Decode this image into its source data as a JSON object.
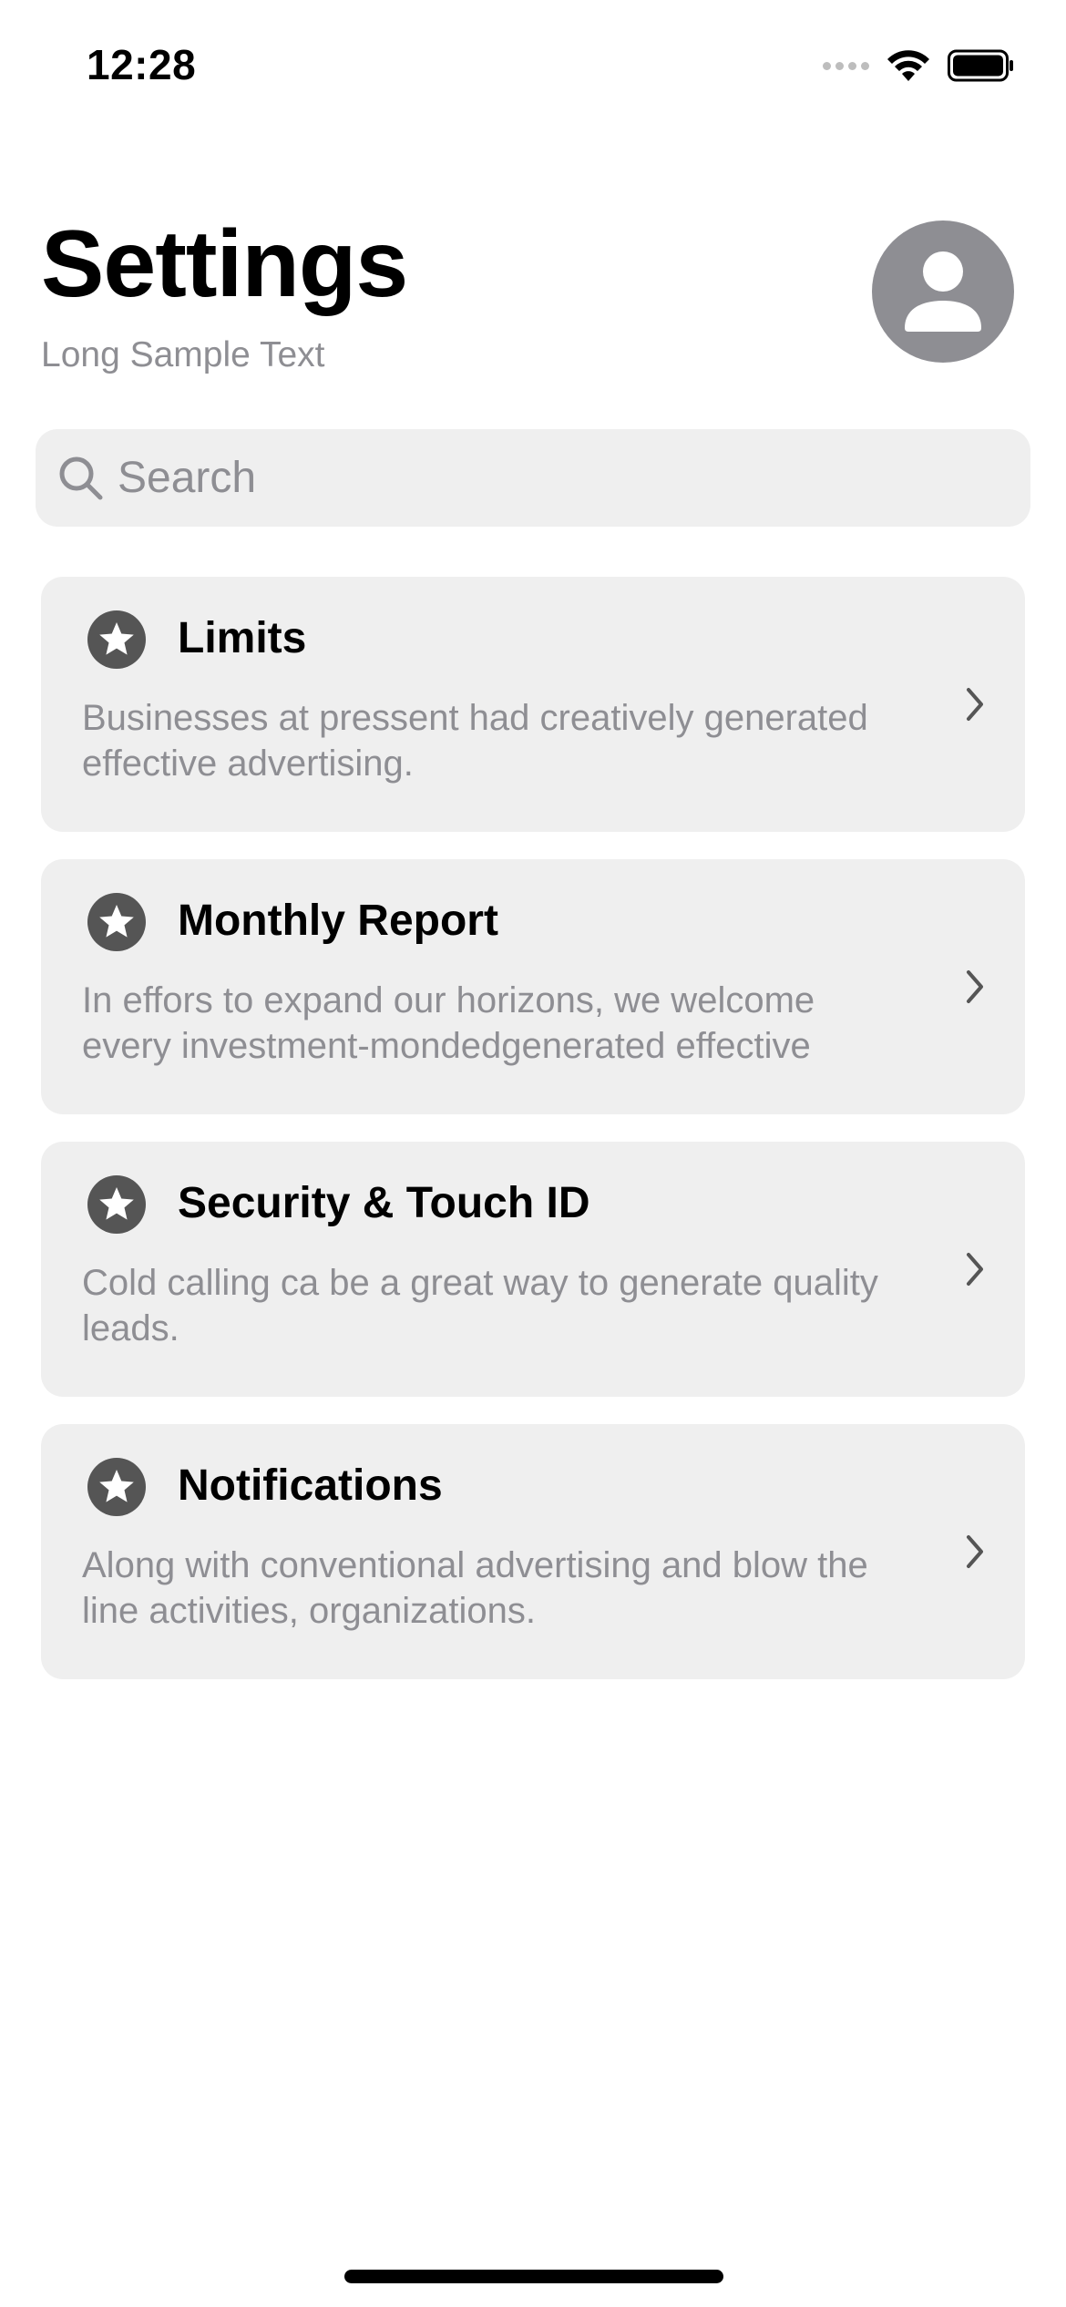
{
  "status_bar": {
    "time": "12:28"
  },
  "header": {
    "title": "Settings",
    "subtitle": "Long Sample Text"
  },
  "search": {
    "placeholder": "Search",
    "value": ""
  },
  "colors": {
    "card_background": "#efefef",
    "icon_fill": "#555555",
    "avatar_background": "#8e8e93",
    "secondary_text": "#8e8e93"
  },
  "items": [
    {
      "title": "Limits",
      "description": "Businesses at pressent had creatively generated effective advertising.",
      "icon": "star-icon"
    },
    {
      "title": "Monthly Report",
      "description": "In effors to expand our horizons, we welcome every investment-mondedgenerated effective",
      "icon": "star-icon"
    },
    {
      "title": "Security & Touch ID",
      "description": "Cold calling ca be a great way to generate quality leads.",
      "icon": "star-icon"
    },
    {
      "title": "Notifications",
      "description": "Along with conventional advertising and blow the line activities, organizations.",
      "icon": "star-icon"
    }
  ]
}
